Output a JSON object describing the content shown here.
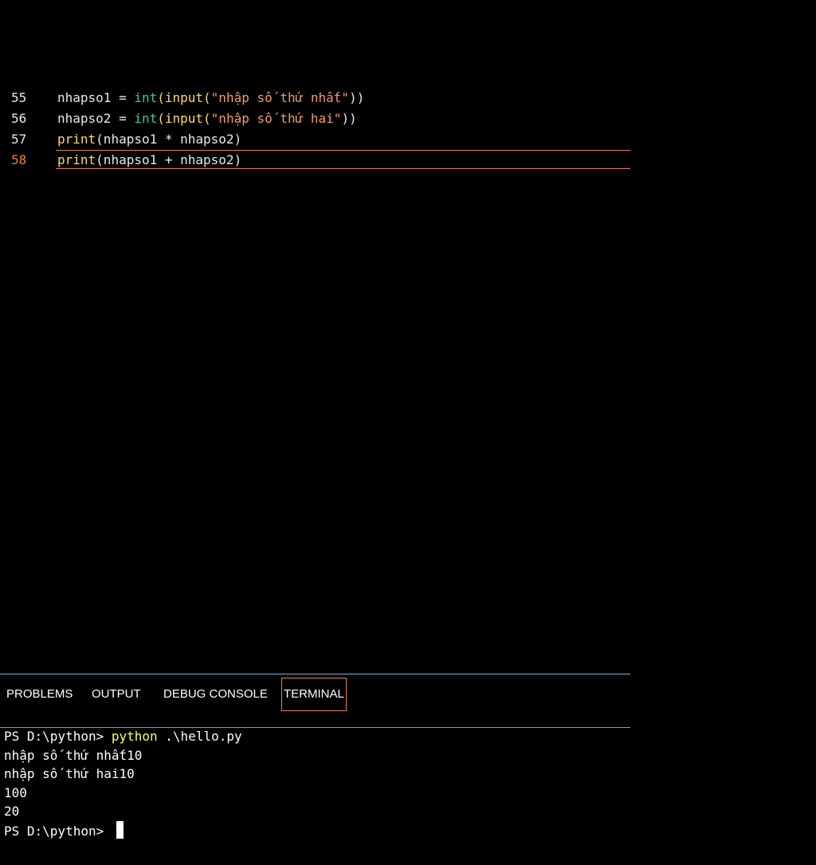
{
  "editor": {
    "lines": [
      {
        "number": "55",
        "tokens": [
          "nhapso1 = ",
          "int",
          "(input(",
          "\"nhập số thứ nhất\"",
          "))"
        ]
      },
      {
        "number": "56",
        "tokens": [
          "nhapso2 = ",
          "int",
          "(input(",
          "\"nhập số thứ hai\"",
          "))"
        ]
      },
      {
        "number": "57",
        "tokens": [
          "print",
          "(nhapso1 * nhapso2)"
        ]
      },
      {
        "number": "58",
        "tokens": [
          "print",
          "(nhapso1 + nhapso2)"
        ]
      }
    ],
    "current_line": "58"
  },
  "panel": {
    "tabs": [
      "PROBLEMS",
      "OUTPUT",
      "DEBUG CONSOLE",
      "TERMINAL"
    ],
    "active_tab": "TERMINAL"
  },
  "terminal": {
    "prompt1": "PS D:\\python> ",
    "command": "python",
    "command_args": " .\\hello.py",
    "out1": "nhập số thứ nhất10",
    "out2": "nhập số thứ hai10",
    "out3": "100",
    "out4": "20",
    "prompt2": "PS D:\\python> "
  },
  "colors": {
    "background": "#000000",
    "accent_orange": "#e8833a",
    "panel_border_blue": "#6fb6d6",
    "function_yellow": "#ffd966",
    "builtin_teal": "#3cc6a0",
    "string_orange": "#ee9d6e",
    "command_yellow": "#ffff66"
  }
}
